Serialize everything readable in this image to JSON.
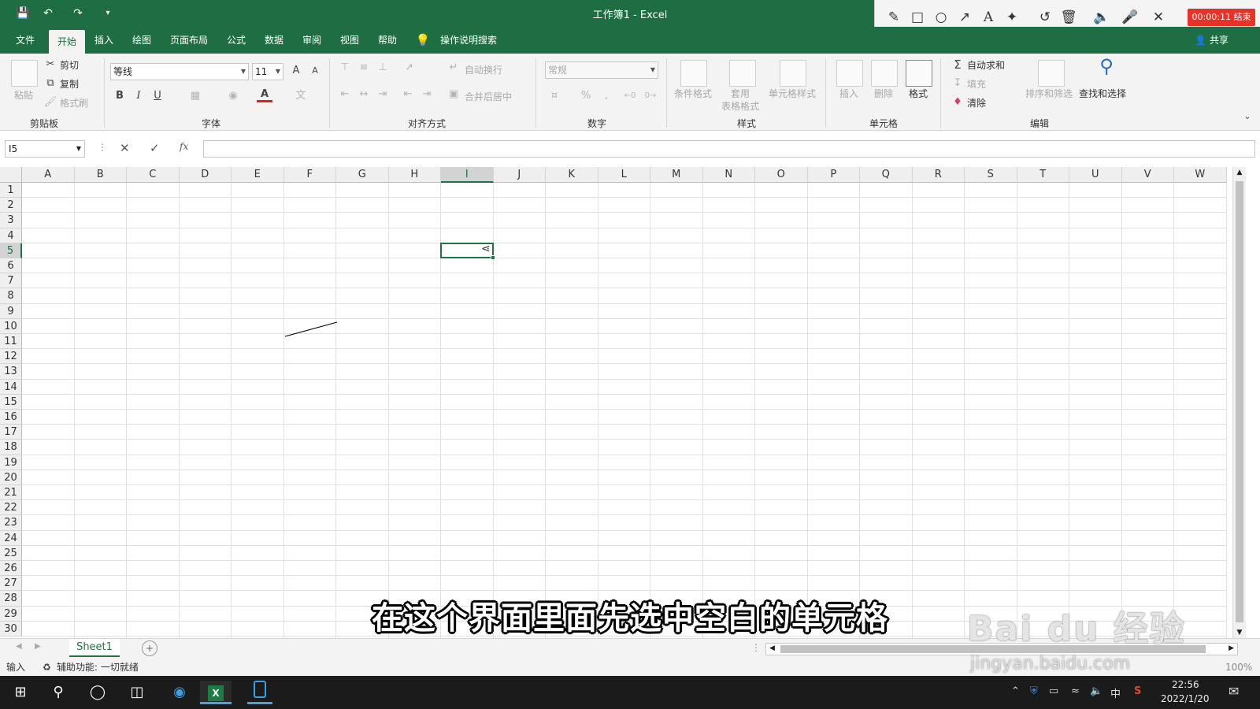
{
  "window": {
    "title": "工作簿1 - Excel"
  },
  "quick_access": {
    "save_icon": "save-icon",
    "undo_icon": "undo-icon",
    "redo_icon": "redo-icon",
    "customize_icon": "customize-qat-icon"
  },
  "recorder": {
    "timer": "00:00:11 结束",
    "tools": [
      "pencil-icon",
      "rectangle-icon",
      "circle-icon",
      "arrow-icon",
      "text-icon",
      "magic-wand-icon",
      "undo-icon",
      "trash-icon",
      "speaker-icon",
      "microphone-icon",
      "close-icon"
    ]
  },
  "tabs": [
    "文件",
    "开始",
    "插入",
    "绘图",
    "页面布局",
    "公式",
    "数据",
    "审阅",
    "视图",
    "帮助"
  ],
  "active_tab": "开始",
  "tell_me": "操作说明搜索",
  "share": "共享",
  "ribbon": {
    "clipboard": {
      "label": "剪贴板",
      "paste": "粘贴",
      "cut": "剪切",
      "copy": "复制",
      "format_painter": "格式刷"
    },
    "font": {
      "label": "字体",
      "name": "等线",
      "size": "11",
      "bold": "B",
      "italic": "I",
      "underline": "U",
      "grow": "A",
      "shrink": "A"
    },
    "alignment": {
      "label": "对齐方式",
      "wrap": "自动换行",
      "merge": "合并后居中"
    },
    "number": {
      "label": "数字",
      "format": "常规",
      "percent": "%",
      "comma": ","
    },
    "styles": {
      "label": "样式",
      "conditional": "条件格式",
      "table1": "套用",
      "table2": "表格格式",
      "cell_styles": "单元格样式"
    },
    "cells": {
      "label": "单元格",
      "insert": "插入",
      "delete": "删除",
      "format": "格式"
    },
    "editing": {
      "label": "编辑",
      "autosum": "自动求和",
      "fill": "填充",
      "clear": "清除",
      "sort": "排序和筛选",
      "find": "查找和选择"
    }
  },
  "formula_bar": {
    "name_box": "I5",
    "fx": "fx",
    "value": ""
  },
  "grid": {
    "columns": [
      "A",
      "B",
      "C",
      "D",
      "E",
      "F",
      "G",
      "H",
      "I",
      "J",
      "K",
      "L",
      "M",
      "N",
      "O",
      "P",
      "Q",
      "R",
      "S",
      "T",
      "U",
      "V",
      "W"
    ],
    "rows": [
      "1",
      "2",
      "3",
      "4",
      "5",
      "6",
      "7",
      "8",
      "9",
      "10",
      "11",
      "12",
      "13",
      "14",
      "15",
      "16",
      "17",
      "18",
      "19",
      "20",
      "21",
      "22",
      "23",
      "24",
      "25",
      "26",
      "27",
      "28",
      "29",
      "30"
    ],
    "selected_column": "I",
    "selected_row": "5"
  },
  "sheets": [
    "Sheet1"
  ],
  "status": {
    "mode": "输入",
    "accessibility": "辅助功能: 一切就绪",
    "zoom": "100%"
  },
  "taskbar": {
    "time": "22:56",
    "date": "2022/1/20",
    "ime": "中"
  },
  "subtitle": "在这个界面里面先选中空白的单元格",
  "watermark": {
    "logo": "Bai du 经验",
    "url": "jingyan.baidu.com"
  }
}
